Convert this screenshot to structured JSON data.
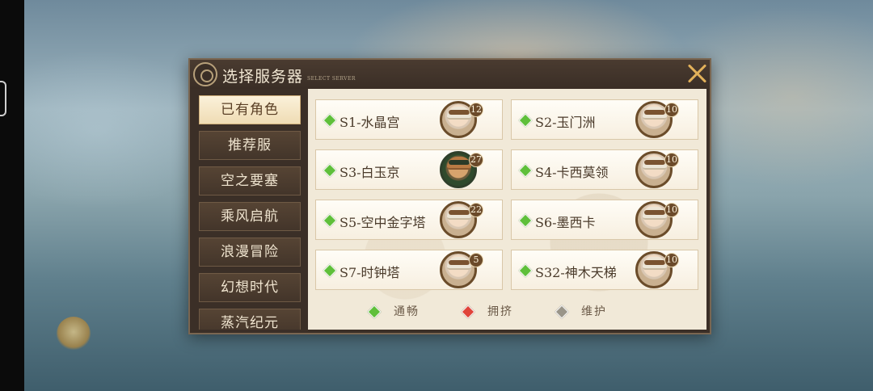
{
  "dialog": {
    "title": "选择服务器",
    "subtitle": "SELECT SERVER"
  },
  "sidebar": {
    "tabs": [
      {
        "label": "已有角色",
        "active": true
      },
      {
        "label": "推荐服",
        "active": false
      },
      {
        "label": "空之要塞",
        "active": false
      },
      {
        "label": "乘风启航",
        "active": false
      },
      {
        "label": "浪漫冒险",
        "active": false
      },
      {
        "label": "幻想时代",
        "active": false
      },
      {
        "label": "蒸汽纪元",
        "active": false
      }
    ]
  },
  "servers": [
    {
      "name": "S1-水晶宫",
      "level": "12",
      "status": "smooth",
      "avatar": "character-portrait-white-hair"
    },
    {
      "name": "S2-玉门洲",
      "level": "10",
      "status": "smooth",
      "avatar": "character-portrait-white-hair"
    },
    {
      "name": "S3-白玉京",
      "level": "27",
      "status": "smooth",
      "avatar": "character-portrait-green-frame"
    },
    {
      "name": "S4-卡西莫领",
      "level": "10",
      "status": "smooth",
      "avatar": "character-portrait-white-hair"
    },
    {
      "name": "S5-空中金字塔",
      "level": "22",
      "status": "smooth",
      "avatar": "character-portrait-ornate-frame"
    },
    {
      "name": "S6-墨西卡",
      "level": "10",
      "status": "smooth",
      "avatar": "character-portrait-white-hair"
    },
    {
      "name": "S7-时钟塔",
      "level": "5",
      "status": "smooth",
      "avatar": "character-portrait-white-hair"
    },
    {
      "name": "S32-神木天梯",
      "level": "10",
      "status": "smooth",
      "avatar": "character-portrait-white-hair"
    }
  ],
  "legend": {
    "smooth": {
      "label": "通畅",
      "color": "#5fbf3a"
    },
    "crowded": {
      "label": "拥挤",
      "color": "#e0443a"
    },
    "maintenance": {
      "label": "维护",
      "color": "#9a9589"
    }
  },
  "colors": {
    "accent_gold": "#e2b15a",
    "panel_dark": "#3b2f27",
    "content_bg": "#f1e9d8"
  }
}
